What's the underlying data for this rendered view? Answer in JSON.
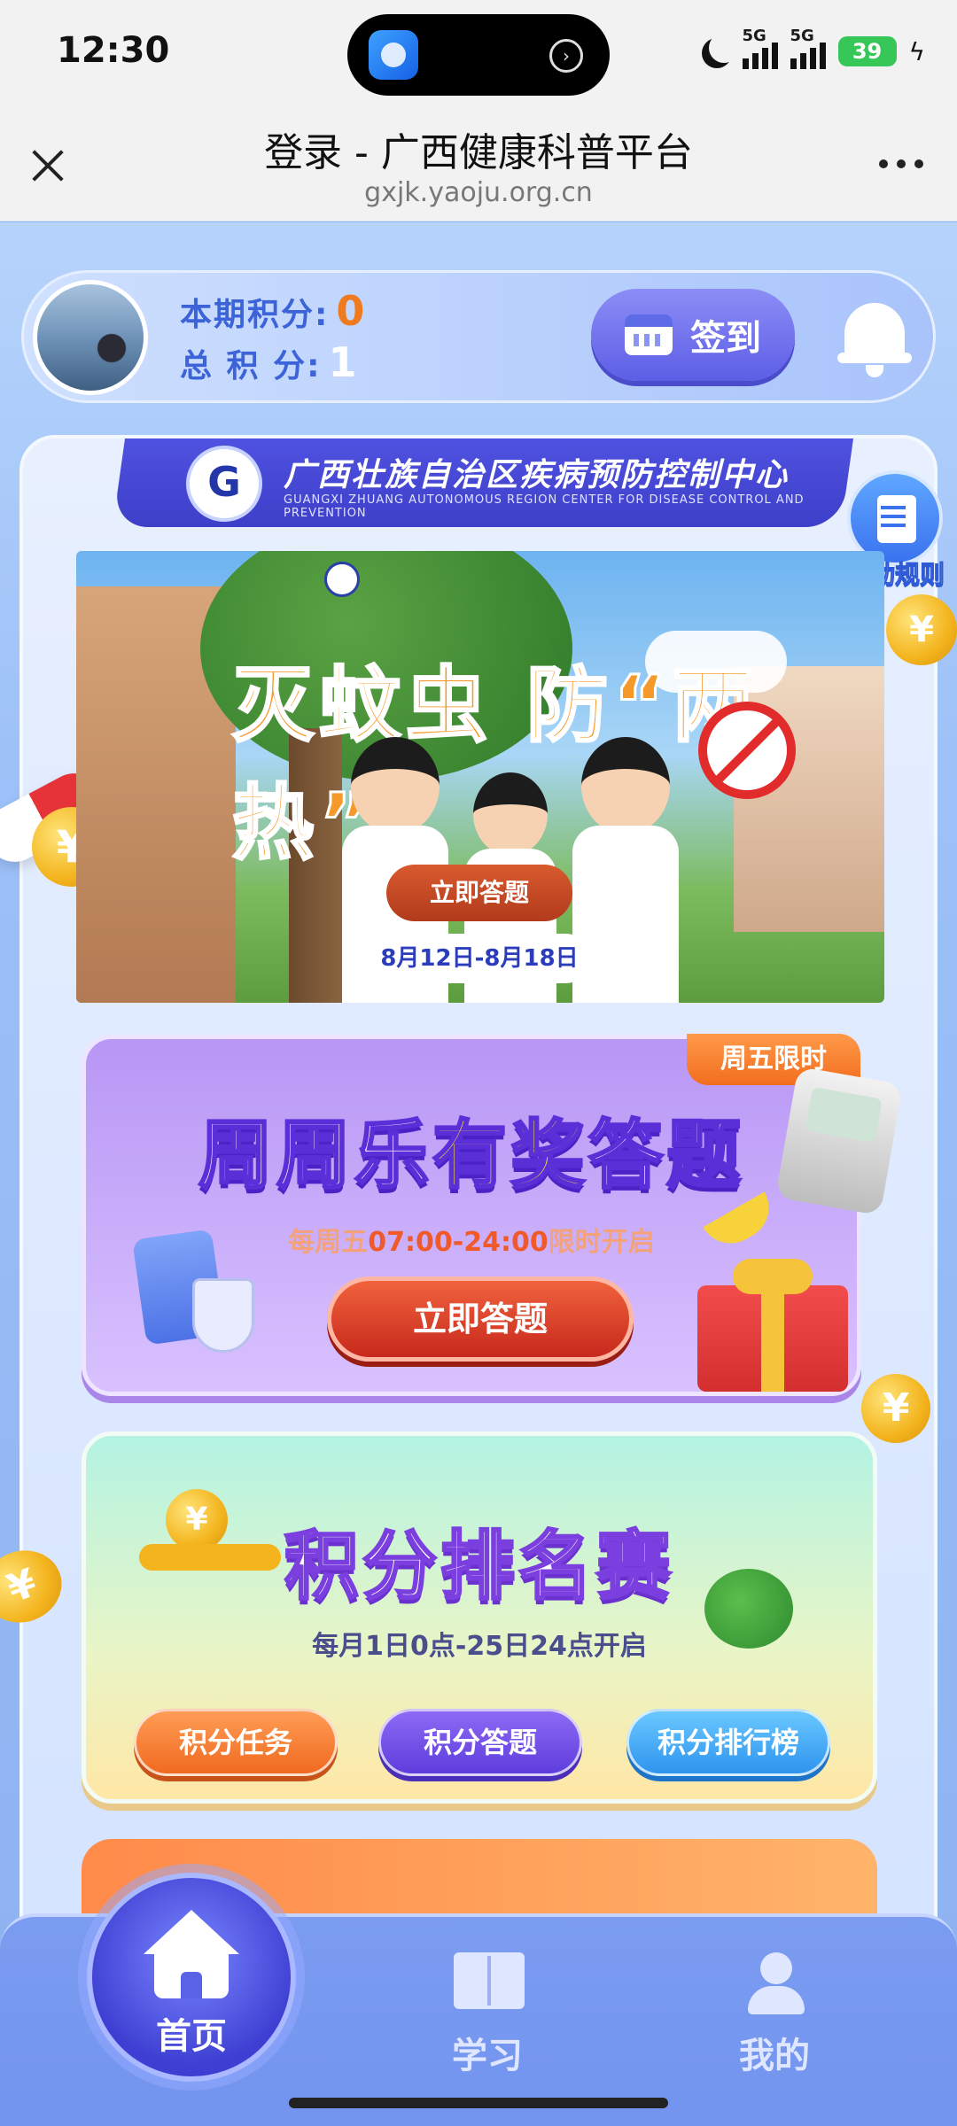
{
  "status_bar": {
    "time": "12:30",
    "signal1_label": "5G",
    "signal2_label": "5G",
    "battery": "39"
  },
  "browser": {
    "title": "登录 - 广西健康科普平台",
    "url": "gxjk.yaoju.org.cn"
  },
  "profile": {
    "period_points_label": "本期积分:",
    "period_points_value": "0",
    "total_points_label": "总 积 分:",
    "total_points_value": "1",
    "checkin_label": "签到"
  },
  "org": {
    "name": "广西壮族自治区疾病预防控制中心",
    "name_en": "GUANGXI ZHUANG AUTONOMOUS REGION CENTER FOR DISEASE CONTROL AND PREVENTION"
  },
  "rules_label": "活动规则",
  "hero": {
    "title": "灭蚊虫 防“两热”",
    "answer_button": "立即答题",
    "date_range": "8月12日-8月18日"
  },
  "quiz": {
    "tag": "周五限时",
    "title_part1": "周周乐",
    "title_highlight": "有奖",
    "title_part2": "答题",
    "subtitle_prefix": "每周五",
    "subtitle_time": "07:00-24:00",
    "subtitle_suffix": "限时开启",
    "button": "立即答题"
  },
  "ranking": {
    "title": "积分排名赛",
    "subtitle": "每月1日0点-25日24点开启",
    "buttons": [
      "积分任务",
      "积分答题",
      "积分排行榜"
    ]
  },
  "tabbar": {
    "home": "首页",
    "study": "学习",
    "mine": "我的"
  },
  "colors": {
    "accent_blue": "#3c63d8",
    "score_orange": "#f07b1f",
    "checkin_purple": "#5c5ee6",
    "tab_bar": "#7394ef"
  }
}
